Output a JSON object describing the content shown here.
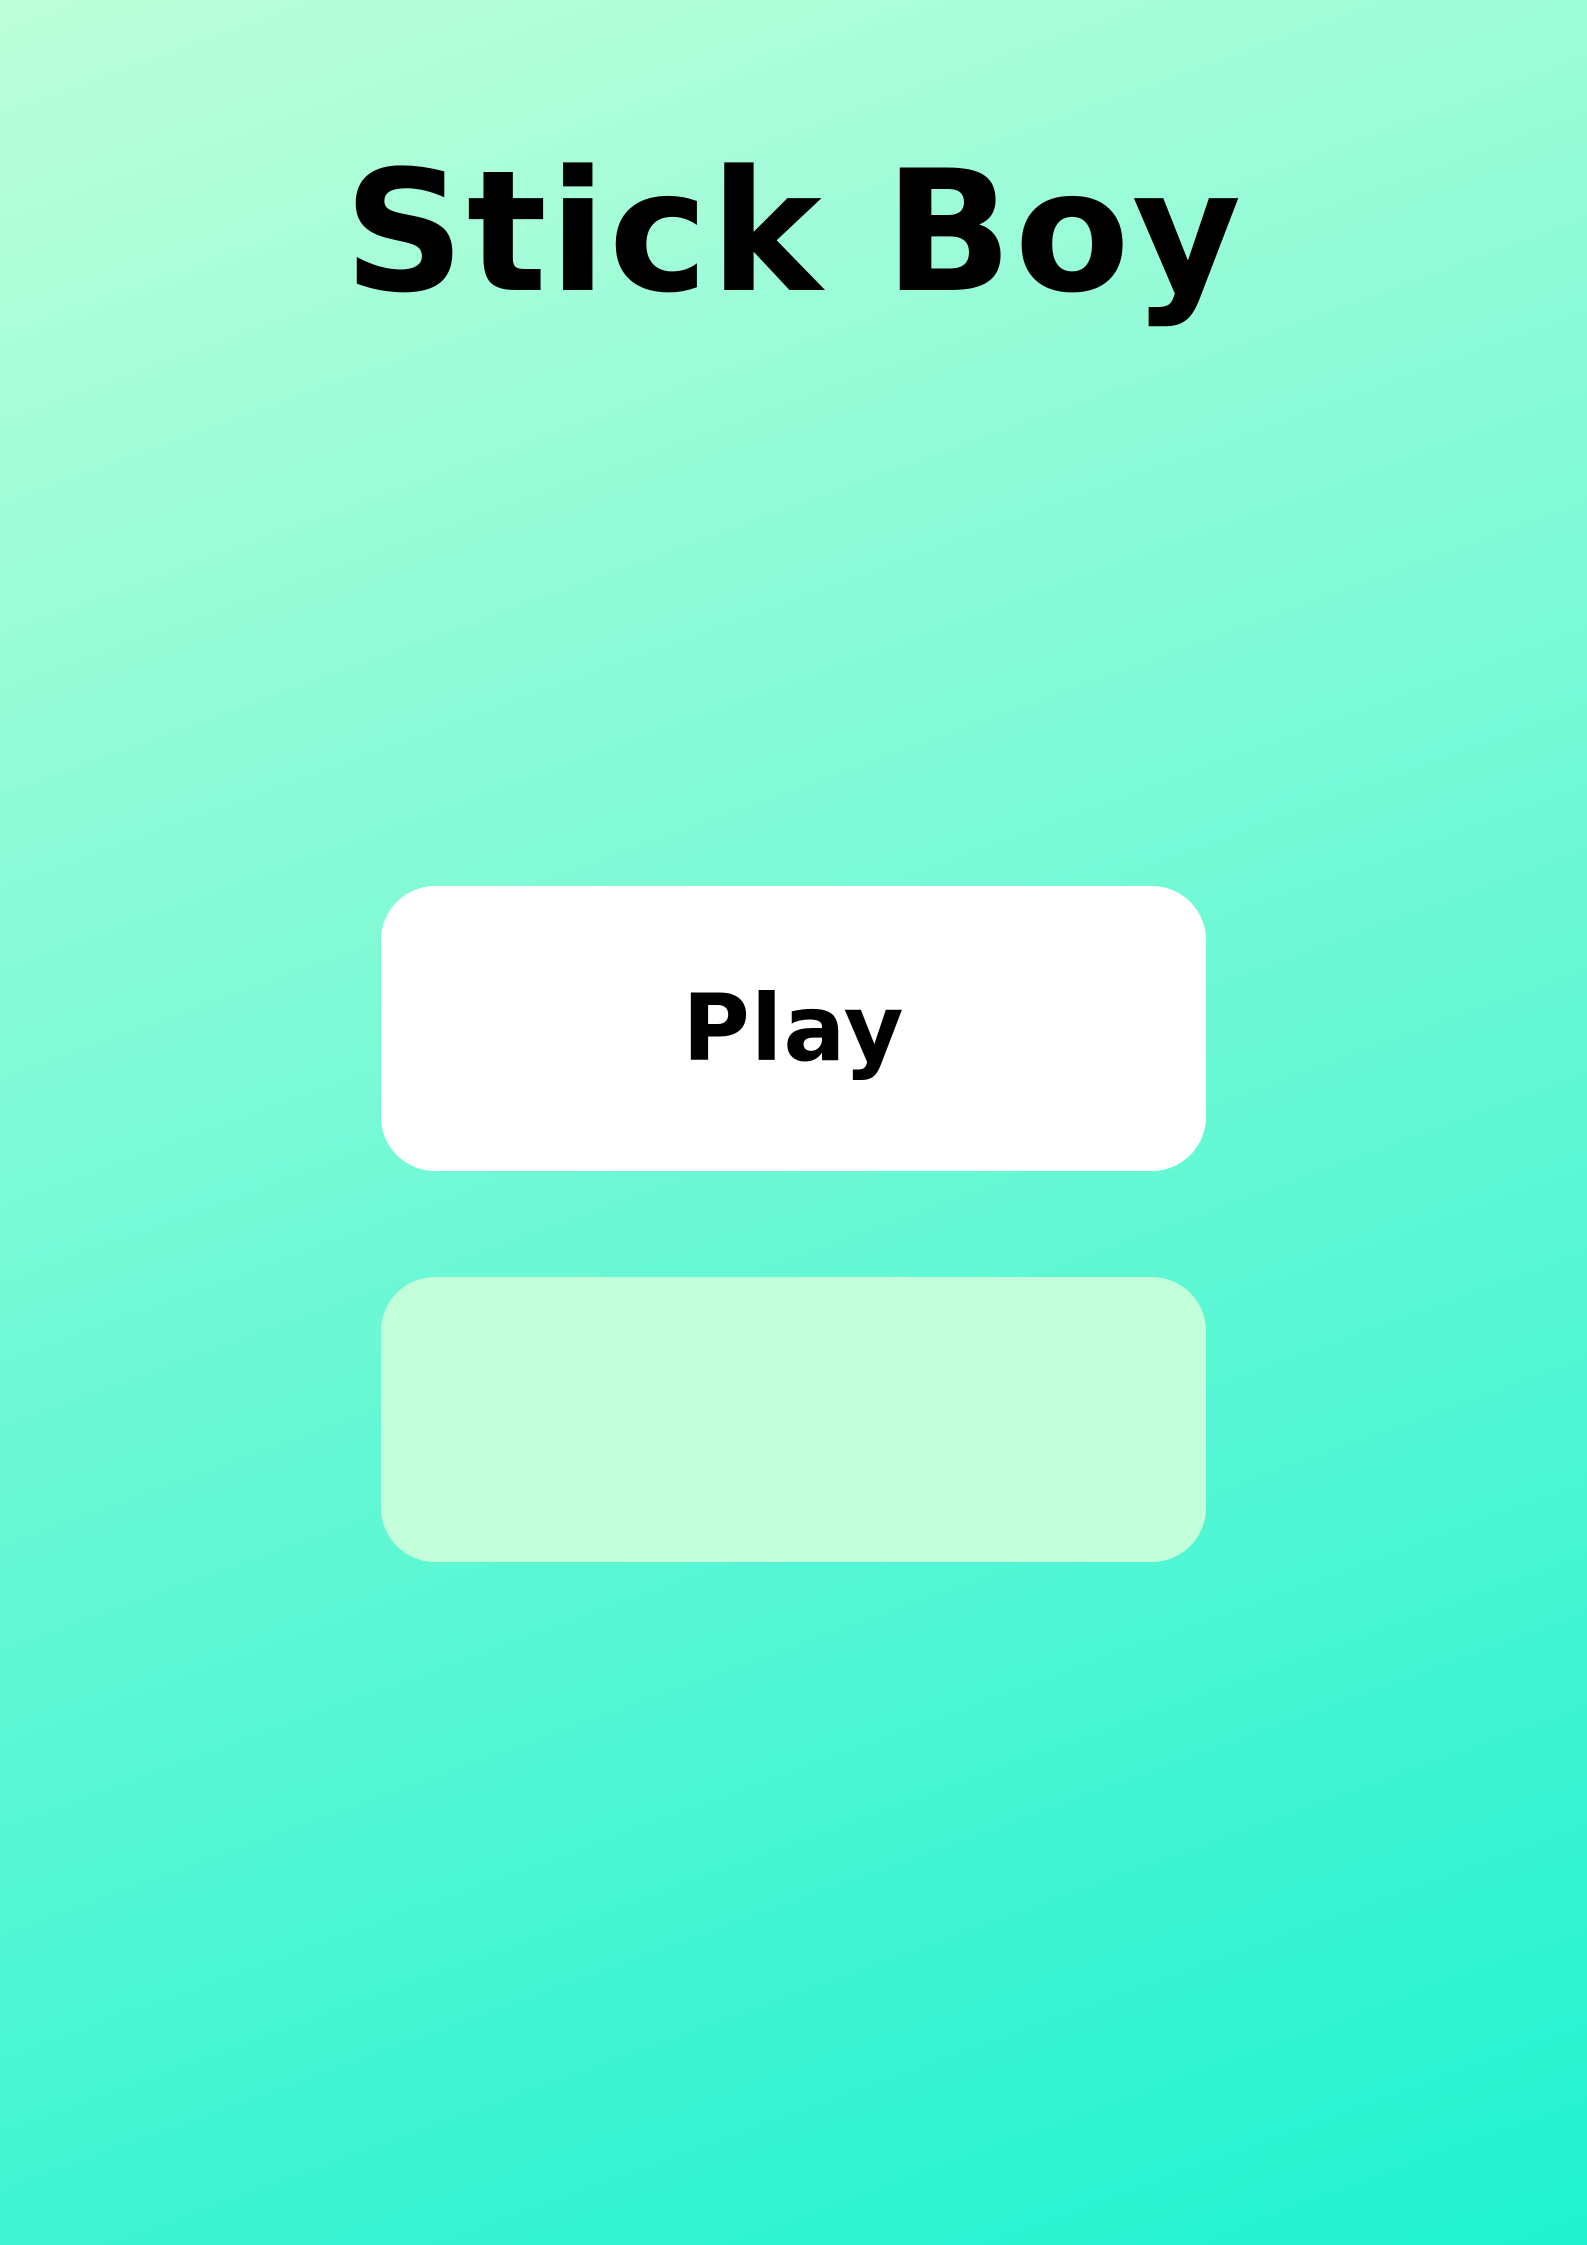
{
  "game": {
    "title": "Stick Boy"
  },
  "menu": {
    "play_label": "Play",
    "second_label": ""
  },
  "colors": {
    "background_top_left": "#BDFFDA",
    "background_bottom_right": "#1FF2D0",
    "play_button_bg": "#FFFFFF",
    "second_button_bg": "#C3FFDA",
    "text": "#000000"
  }
}
